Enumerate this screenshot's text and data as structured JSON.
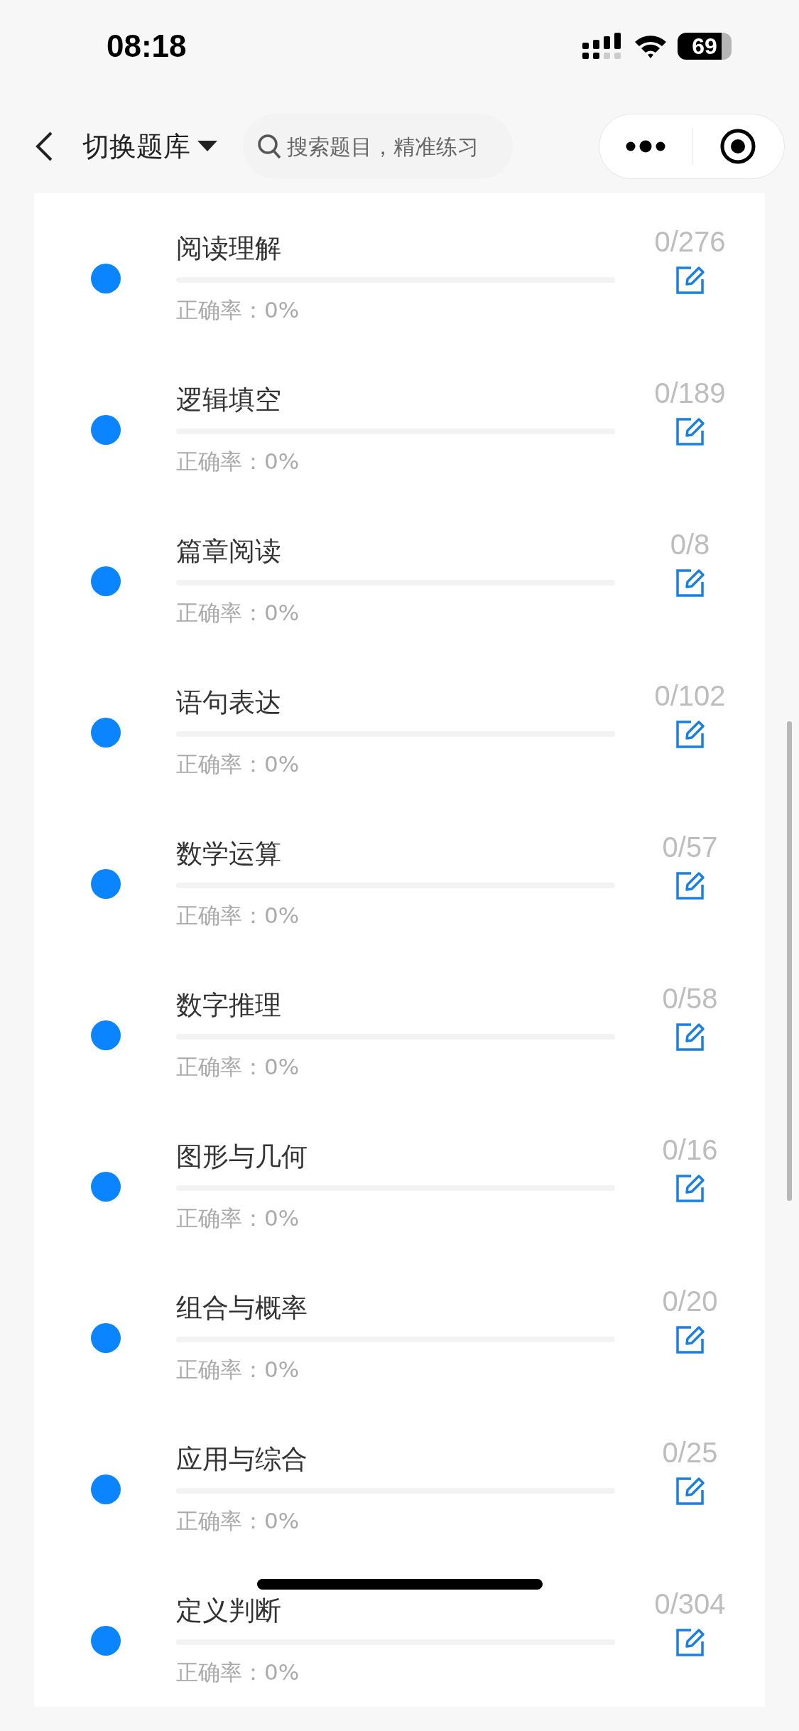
{
  "status_bar": {
    "time": "08:18",
    "battery": "69"
  },
  "header": {
    "title": "切换题库",
    "search": {
      "placeholder": "搜索题目，精准练习"
    }
  },
  "categories": [
    {
      "name": "阅读理解",
      "count": "0/276",
      "accuracy": "正确率：0%",
      "level": 0,
      "color": "#0a84ff"
    },
    {
      "name": "逻辑填空",
      "count": "0/189",
      "accuracy": "正确率：0%",
      "level": 0,
      "color": "#0a84ff"
    },
    {
      "name": "篇章阅读",
      "count": "0/8",
      "accuracy": "正确率：0%",
      "level": 0,
      "color": "#0a84ff"
    },
    {
      "name": "语句表达",
      "count": "0/102",
      "accuracy": "正确率：0%",
      "level": 0,
      "color": "#0a84ff"
    },
    {
      "name": "数学运算",
      "count": "0/57",
      "accuracy": "正确率：0%",
      "level": 0,
      "color": "#0a84ff"
    },
    {
      "name": "数字推理",
      "count": "0/58",
      "accuracy": "正确率：0%",
      "level": 0,
      "color": "#0a84ff"
    },
    {
      "name": "图形与几何",
      "count": "0/16",
      "accuracy": "正确率：0%",
      "level": 0,
      "color": "#0a84ff"
    },
    {
      "name": "组合与概率",
      "count": "0/20",
      "accuracy": "正确率：0%",
      "level": 0,
      "color": "#0a84ff"
    },
    {
      "name": "应用与综合",
      "count": "0/25",
      "accuracy": "正确率：0%",
      "level": 0,
      "color": "#0a84ff"
    },
    {
      "name": "定义判断",
      "count": "0/304",
      "accuracy": "正确率：0%",
      "level": 0,
      "color": "#0a84ff"
    }
  ]
}
